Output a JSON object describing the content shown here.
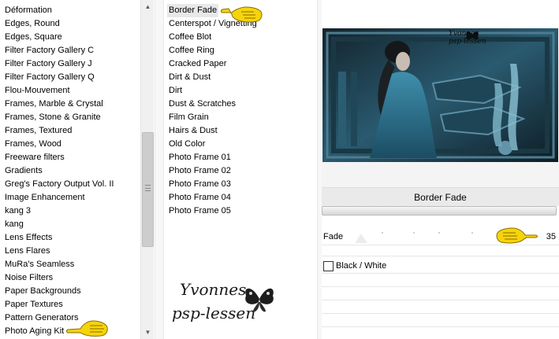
{
  "categories": [
    "Déformation",
    "Edges, Round",
    "Edges, Square",
    "Filter Factory Gallery C",
    "Filter Factory Gallery J",
    "Filter Factory Gallery Q",
    "Flou-Mouvement",
    "Frames, Marble & Crystal",
    "Frames, Stone & Granite",
    "Frames, Textured",
    "Frames, Wood",
    "Freeware filters",
    "Gradients",
    "Greg's Factory Output Vol. II",
    "Image Enhancement",
    "kang 3",
    "kang",
    "Lens Effects",
    "Lens Flares",
    "MuRa's Seamless",
    "Noise Filters",
    "Paper Backgrounds",
    "Paper Textures",
    "Pattern Generators",
    "Photo Aging Kit"
  ],
  "filters": [
    "Border Fade",
    "Centerspot / Vignetting",
    "Coffee Blot",
    "Coffee Ring",
    "Cracked Paper",
    "Dirt & Dust",
    "Dirt",
    "Dust & Scratches",
    "Film Grain",
    "Hairs & Dust",
    "Old Color",
    "Photo Frame 01",
    "Photo Frame 02",
    "Photo Frame 03",
    "Photo Frame 04",
    "Photo Frame 05"
  ],
  "selected_filter": "Border Fade",
  "filter_title": "Border Fade",
  "fade": {
    "label": "Fade",
    "value": "35"
  },
  "black_white": {
    "label": "Black / White",
    "checked": false
  },
  "watermark": {
    "line1": "Yvonnes",
    "line2": "psp-lessen"
  },
  "preview_watermark": {
    "line1": "Yvonnes",
    "line2": "psp-lessen"
  },
  "colors": {
    "hand": "#f6d40a",
    "preview_accent": "#2f6f8a"
  },
  "icons": [
    "scroll-up-icon",
    "scroll-down-icon",
    "scroll-grip-icon",
    "pointing-hand-icon",
    "butterfly-icon"
  ]
}
